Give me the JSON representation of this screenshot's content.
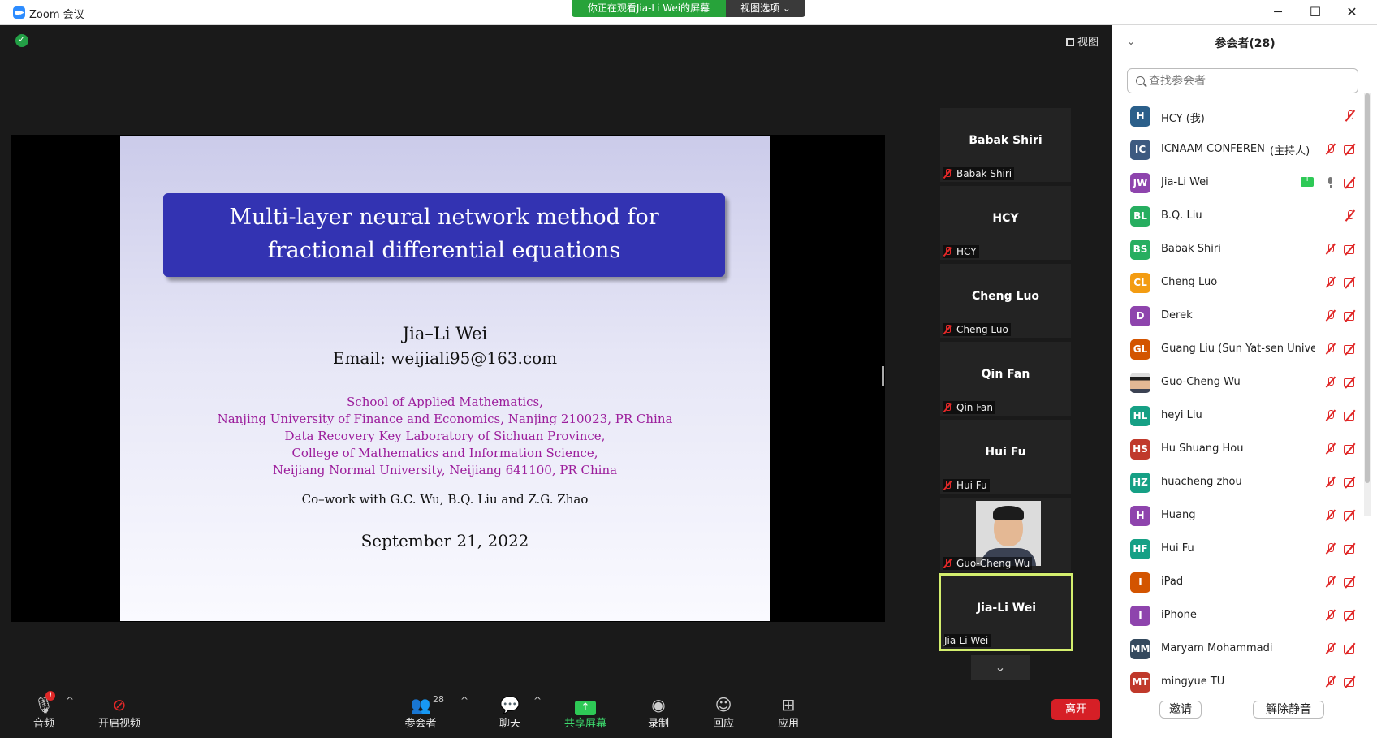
{
  "window": {
    "title": "Zoom 会议",
    "share_banner": "你正在观看Jia-Li Wei的屏幕",
    "view_options": "视图选项 ⌄",
    "view_button": "视图"
  },
  "slide": {
    "title_line1": "Multi-layer neural network method for",
    "title_line2": "fractional differential equations",
    "author": "Jia–Li Wei",
    "email": "Email: weijiali95@163.com",
    "affiliations": [
      "School of Applied Mathematics,",
      "Nanjing University of Finance and Economics, Nanjing 210023, PR China",
      "Data Recovery Key Laboratory of Sichuan Province,",
      "College of Mathematics and Information Science,",
      "Neijiang Normal University, Neijiang 641100, PR China"
    ],
    "cowork": "Co–work with G.C. Wu, B.Q. Liu and Z.G. Zhao",
    "date": "September 21, 2022"
  },
  "thumbnails": [
    {
      "name": "Babak Shiri",
      "label": "Babak Shiri"
    },
    {
      "name": "HCY",
      "label": "HCY"
    },
    {
      "name": "Cheng Luo",
      "label": "Cheng Luo"
    },
    {
      "name": "Qin Fan",
      "label": "Qin Fan"
    },
    {
      "name": "Hui Fu",
      "label": "Hui Fu"
    },
    {
      "name": "",
      "label": "Guo-Cheng Wu"
    },
    {
      "name": "Jia-Li Wei",
      "label": "Jia-Li Wei"
    }
  ],
  "toolbar": {
    "audio": "音频",
    "audio_badge": "!",
    "video": "开启视频",
    "participants": "参会者",
    "participants_count": "28",
    "chat": "聊天",
    "share": "共享屏幕",
    "record": "录制",
    "reactions": "回应",
    "apps": "应用",
    "leave": "离开"
  },
  "panel": {
    "title": "参会者(28)",
    "search_placeholder": "查找参会者",
    "invite": "邀请",
    "unmute_all": "解除静音",
    "participants": [
      {
        "initials": "H",
        "name": "HCY (我)",
        "color": "#2b5f8a",
        "mic": "muted",
        "cam": "none"
      },
      {
        "initials": "IC",
        "name": "ICNAAM CONFEREN...",
        "tag": "(主持人)",
        "color": "#3d5a80",
        "mic": "muted",
        "cam": "off"
      },
      {
        "initials": "JW",
        "name": "Jia-Li Wei",
        "color": "#8e44ad",
        "mic": "on",
        "cam": "off",
        "sharing": true
      },
      {
        "initials": "BL",
        "name": "B.Q. Liu",
        "color": "#27ae60",
        "mic": "muted",
        "cam": "none"
      },
      {
        "initials": "BS",
        "name": "Babak Shiri",
        "color": "#27ae60",
        "mic": "muted",
        "cam": "off"
      },
      {
        "initials": "CL",
        "name": "Cheng Luo",
        "color": "#f39c12",
        "mic": "muted",
        "cam": "off"
      },
      {
        "initials": "D",
        "name": "Derek",
        "color": "#8e44ad",
        "mic": "muted",
        "cam": "off"
      },
      {
        "initials": "GL",
        "name": "Guang Liu (Sun Yat-sen Univers...",
        "color": "#d35400",
        "mic": "muted",
        "cam": "off"
      },
      {
        "initials": "",
        "name": "Guo-Cheng Wu",
        "color": "#d9d9d9",
        "mic": "muted",
        "cam": "off",
        "photo": true
      },
      {
        "initials": "HL",
        "name": "heyi Liu",
        "color": "#16a085",
        "mic": "muted",
        "cam": "off"
      },
      {
        "initials": "HS",
        "name": "Hu Shuang Hou",
        "color": "#c0392b",
        "mic": "muted",
        "cam": "off"
      },
      {
        "initials": "HZ",
        "name": "huacheng zhou",
        "color": "#16a085",
        "mic": "muted",
        "cam": "off"
      },
      {
        "initials": "H",
        "name": "Huang",
        "color": "#8e44ad",
        "mic": "muted",
        "cam": "off"
      },
      {
        "initials": "HF",
        "name": "Hui Fu",
        "color": "#16a085",
        "mic": "muted",
        "cam": "off"
      },
      {
        "initials": "I",
        "name": "iPad",
        "color": "#d35400",
        "mic": "muted",
        "cam": "off"
      },
      {
        "initials": "I",
        "name": "iPhone",
        "color": "#8e44ad",
        "mic": "muted",
        "cam": "off"
      },
      {
        "initials": "MM",
        "name": "Maryam Mohammadi",
        "color": "#34495e",
        "mic": "muted",
        "cam": "off"
      },
      {
        "initials": "MT",
        "name": "mingyue TU",
        "color": "#c0392b",
        "mic": "muted",
        "cam": "off"
      }
    ]
  }
}
